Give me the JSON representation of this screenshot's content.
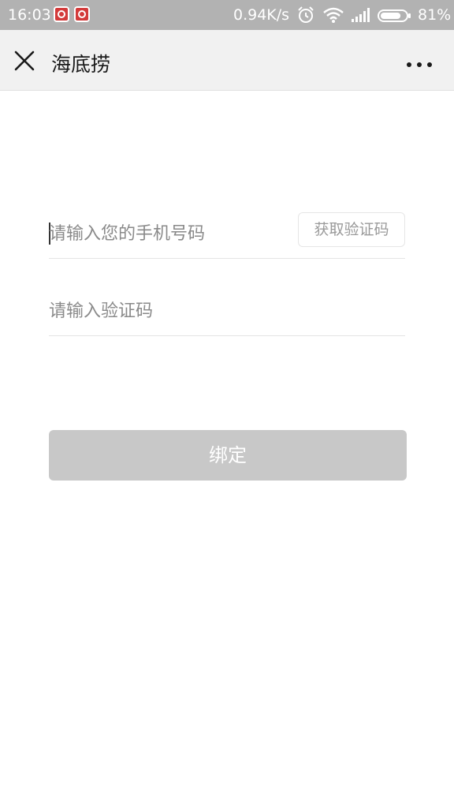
{
  "status_bar": {
    "time": "16:03",
    "network_speed": "0.94K/s",
    "battery_percent": "81%",
    "battery_level": 0.81,
    "icons": [
      "app-notification-icon",
      "app-notification-icon",
      "alarm-icon",
      "wifi-icon",
      "signal-icon",
      "battery-icon"
    ]
  },
  "header": {
    "title": "海底捞",
    "close_icon": "close-icon",
    "more_icon": "more-dots-icon"
  },
  "form": {
    "phone_placeholder": "请输入您的手机号码",
    "phone_value": "",
    "get_code_label": "获取验证码",
    "code_placeholder": "请输入验证码",
    "code_value": ""
  },
  "bind_button": {
    "label": "绑定",
    "enabled": false
  },
  "colors": {
    "status_bar_bg": "#b2b2b2",
    "header_bg": "#f1f1f1",
    "disabled_button_bg": "#c8c8c8"
  }
}
